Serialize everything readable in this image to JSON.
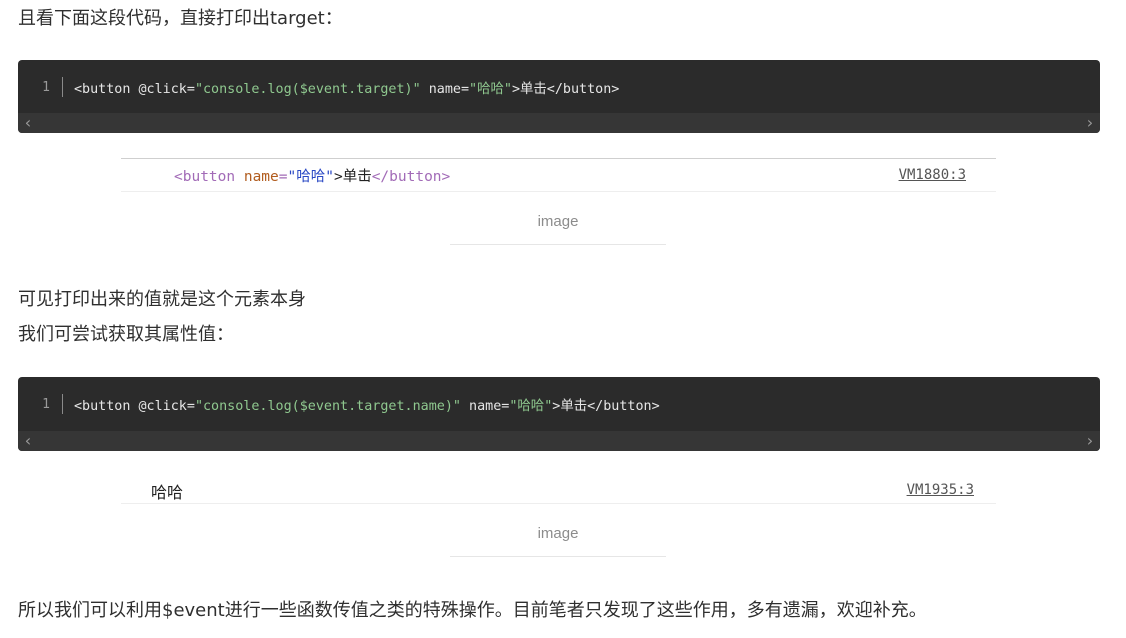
{
  "text": {
    "intro": "且看下面这段代码，直接打印出target：",
    "result1": "可见打印出来的值就是这个元素本身",
    "try_attr": "我们可尝试获取其属性值：",
    "conclusion": "所以我们可以利用$event进行一些函数传值之类的特殊操作。目前笔者只发现了这些作用，多有遗漏，欢迎补充。"
  },
  "code1": {
    "line_no": "1",
    "tag_open": "<button ",
    "attr_click": "@click=",
    "str_click": "\"console.log($event.target)\"",
    "attr_name": " name=",
    "str_name": "\"哈哈\"",
    "rest": ">单击</button>"
  },
  "code2": {
    "line_no": "1",
    "tag_open": "<button ",
    "attr_click": "@click=",
    "str_click": "\"console.log($event.target.name)\"",
    "attr_name": " name=",
    "str_name": "\"哈哈\"",
    "rest": ">单击</button>"
  },
  "console1": {
    "tag_open": "<button",
    "attr": " name",
    "eq": "=",
    "value": "\"哈哈\"",
    "text": ">单击",
    "tag_close": "</button>",
    "source": "VM1880:3"
  },
  "console2": {
    "message": "哈哈",
    "source": "VM1935:3"
  },
  "captions": {
    "img1": "image",
    "img2": "image"
  },
  "icons": {
    "scroll_left": "chevron-left-icon",
    "scroll_right": "chevron-right-icon"
  }
}
